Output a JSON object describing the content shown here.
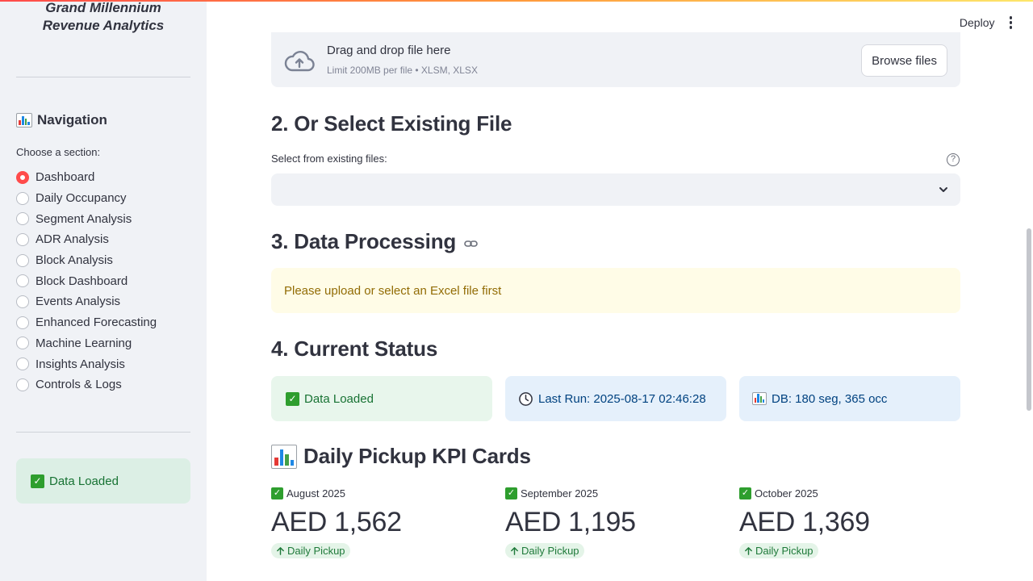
{
  "sidebar": {
    "brand_line1": "Grand Millennium",
    "brand_line2": "Revenue Analytics",
    "nav_heading": "Navigation",
    "choose_label": "Choose a section:",
    "items": [
      {
        "label": "Dashboard",
        "selected": true
      },
      {
        "label": "Daily Occupancy",
        "selected": false
      },
      {
        "label": "Segment Analysis",
        "selected": false
      },
      {
        "label": "ADR Analysis",
        "selected": false
      },
      {
        "label": "Block Analysis",
        "selected": false
      },
      {
        "label": "Block Dashboard",
        "selected": false
      },
      {
        "label": "Events Analysis",
        "selected": false
      },
      {
        "label": "Enhanced Forecasting",
        "selected": false
      },
      {
        "label": "Machine Learning",
        "selected": false
      },
      {
        "label": "Insights Analysis",
        "selected": false
      },
      {
        "label": "Controls & Logs",
        "selected": false
      }
    ],
    "status": "Data Loaded"
  },
  "header": {
    "deploy_label": "Deploy"
  },
  "uploader": {
    "title": "Drag and drop file here",
    "limit": "Limit 200MB per file • XLSM, XLSX",
    "browse_label": "Browse files"
  },
  "section2": {
    "title": "2. Or Select Existing File",
    "field_label": "Select from existing files:",
    "help_symbol": "?",
    "selected_value": ""
  },
  "section3": {
    "title": "3. Data Processing",
    "warning": "Please upload or select an Excel file first"
  },
  "section4": {
    "title": "4. Current Status",
    "cards": {
      "loaded": "Data Loaded",
      "last_run": "Last Run: 2025-08-17 02:46:28",
      "db": "DB: 180 seg, 365 occ"
    }
  },
  "kpi": {
    "title": "Daily Pickup KPI Cards",
    "cards": [
      {
        "label": "August 2025",
        "value": "AED 1,562",
        "delta": "Daily Pickup"
      },
      {
        "label": "September 2025",
        "value": "AED 1,195",
        "delta": "Daily Pickup"
      },
      {
        "label": "October 2025",
        "value": "AED 1,369",
        "delta": "Daily Pickup"
      }
    ]
  },
  "colors": {
    "accent": "#ff4b4b",
    "sidebar_bg": "#f0f2f6",
    "success_bg": "#e8f6ec",
    "success_text": "#177233",
    "info_bg": "#e5f0fb",
    "info_text": "#004280",
    "warning_bg": "#fffce7",
    "warning_text": "#926c05"
  },
  "icons": {
    "navigation": "bar-chart-icon",
    "status_loaded": "check-mark-icon",
    "last_run": "clock-icon",
    "db": "bar-chart-icon",
    "upload": "cloud-upload-icon",
    "kpi_delta": "arrow-up-icon"
  }
}
